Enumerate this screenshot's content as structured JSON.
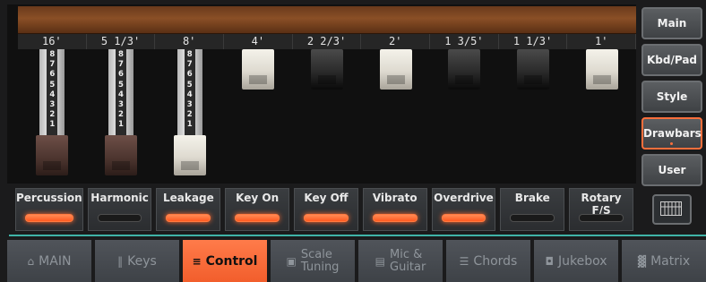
{
  "footages": [
    "16'",
    "5 1/3'",
    "8'",
    "4'",
    "2 2/3'",
    "2'",
    "1 3/5'",
    "1 1/3'",
    "1'"
  ],
  "drawbar_scale": [
    "8",
    "7",
    "6",
    "5",
    "4",
    "3",
    "2",
    "1"
  ],
  "drawbars": [
    {
      "level": 8,
      "color": "brown"
    },
    {
      "level": 8,
      "color": "brown"
    },
    {
      "level": 8,
      "color": "white"
    },
    {
      "level": 0,
      "color": "white"
    },
    {
      "level": 0,
      "color": "black"
    },
    {
      "level": 0,
      "color": "white"
    },
    {
      "level": 0,
      "color": "black"
    },
    {
      "level": 0,
      "color": "black"
    },
    {
      "level": 0,
      "color": "white"
    }
  ],
  "switches": [
    {
      "label": "Percussion",
      "on": true
    },
    {
      "label": "Harmonic",
      "on": false
    },
    {
      "label": "Leakage",
      "on": true
    },
    {
      "label": "Key On",
      "on": true
    },
    {
      "label": "Key Off",
      "on": true
    },
    {
      "label": "Vibrato",
      "on": true
    },
    {
      "label": "Overdrive",
      "on": true
    },
    {
      "label": "Brake",
      "on": false
    },
    {
      "label": "Rotary F/S",
      "on": false
    }
  ],
  "side_buttons": [
    {
      "label": "Main",
      "active": false
    },
    {
      "label": "Kbd/Pad",
      "active": false
    },
    {
      "label": "Style",
      "active": false
    },
    {
      "label": "Drawbars",
      "active": true
    },
    {
      "label": "User",
      "active": false
    }
  ],
  "tabs": [
    {
      "label": "MAIN",
      "icon": "home-icon",
      "active": false
    },
    {
      "label": "Keys",
      "icon": "keys-icon",
      "active": false
    },
    {
      "label": "Control",
      "icon": "sliders-icon",
      "active": true
    },
    {
      "label": "Scale\nTuning",
      "icon": "scale-icon",
      "active": false
    },
    {
      "label": "Mic &\nGuitar",
      "icon": "mic-icon",
      "active": false
    },
    {
      "label": "Chords",
      "icon": "list-icon",
      "active": false
    },
    {
      "label": "Jukebox",
      "icon": "jukebox-icon",
      "active": false
    },
    {
      "label": "Matrix",
      "icon": "grid-icon",
      "active": false
    }
  ],
  "colors": {
    "accent": "#ff6f3c",
    "divider": "#3fb3a7"
  }
}
